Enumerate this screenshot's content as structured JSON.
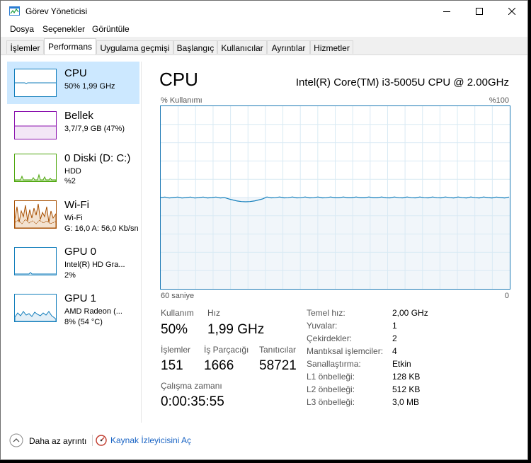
{
  "window": {
    "title": "Görev Yöneticisi"
  },
  "menu": [
    "Dosya",
    "Seçenekler",
    "Görüntüle"
  ],
  "tabs": [
    "İşlemler",
    "Performans",
    "Uygulama geçmişi",
    "Başlangıç",
    "Kullanıcılar",
    "Ayrıntılar",
    "Hizmetler"
  ],
  "active_tab": "Performans",
  "sidebar": {
    "items": [
      {
        "title": "CPU",
        "line1": "50%  1,99 GHz",
        "line2": "",
        "color": "#117dbb"
      },
      {
        "title": "Bellek",
        "line1": "3,7/7,9 GB (47%)",
        "line2": "",
        "color": "#8b12ae"
      },
      {
        "title": "0 Diski (D: C:)",
        "line1": "HDD",
        "line2": "%2",
        "color": "#4da60c"
      },
      {
        "title": "Wi-Fi",
        "line1": "Wi-Fi",
        "line2": "G: 16,0  A: 56,0 Kb/sn",
        "color": "#a74f01"
      },
      {
        "title": "GPU 0",
        "line1": "Intel(R) HD Gra...",
        "line2": "2%",
        "color": "#117dbb"
      },
      {
        "title": "GPU 1",
        "line1": "AMD Radeon (...",
        "line2": "8% (54 °C)",
        "color": "#117dbb"
      }
    ]
  },
  "cpu": {
    "header": "CPU",
    "model": "Intel(R) Core(TM) i3-5005U CPU @ 2.00GHz",
    "graph": {
      "top_left_label": "% Kullanımı",
      "top_right_label": "%100",
      "bottom_left_label": "60 saniye",
      "bottom_right_label": "0",
      "utilization_percent": 50,
      "ymax_percent": 100
    },
    "stats": {
      "usage_label": "Kullanım",
      "usage_value": "50%",
      "speed_label": "Hız",
      "speed_value": "1,99 GHz",
      "processes_label": "İşlemler",
      "processes_value": "151",
      "threads_label": "İş Parçacığı",
      "threads_value": "1666",
      "handles_label": "Tanıtıcılar",
      "handles_value": "58721",
      "uptime_label": "Çalışma zamanı",
      "uptime_value": "0:00:35:55"
    },
    "specs": [
      {
        "label": "Temel hız:",
        "value": "2,00 GHz"
      },
      {
        "label": "Yuvalar:",
        "value": "1"
      },
      {
        "label": "Çekirdekler:",
        "value": "2"
      },
      {
        "label": "Mantıksal işlemciler:",
        "value": "4"
      },
      {
        "label": "Sanallaştırma:",
        "value": "Etkin"
      },
      {
        "label": "L1 önbelleği:",
        "value": "128 KB"
      },
      {
        "label": "L2 önbelleği:",
        "value": "512 KB"
      },
      {
        "label": "L3 önbelleği:",
        "value": "3,0 MB"
      }
    ]
  },
  "footer": {
    "fewer_details": "Daha az ayrıntı",
    "resource_monitor": "Kaynak İzleyicisini Aç"
  },
  "colors": {
    "accent": "#117dbb",
    "selected_bg": "#cce8ff",
    "graph_fill": "#f1f6fa",
    "graph_grid": "#d9eaf4",
    "link": "#1a64c4"
  },
  "icons": {
    "app": "task-manager-icon",
    "fewer_details": "chevron-up-icon",
    "resource_monitor": "resource-monitor-icon"
  }
}
